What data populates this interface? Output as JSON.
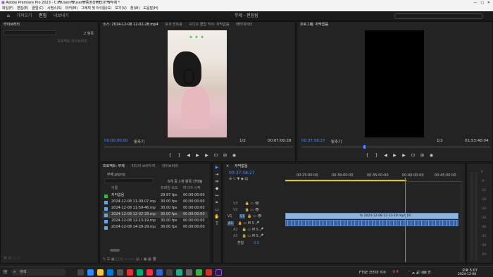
{
  "window": {
    "title": "Adobe Premiere Pro 2023 - C:₩Users₩user₩동영상₩EDIT₩무제 *"
  },
  "menu": [
    "파일(F)",
    "편집(E)",
    "클립(C)",
    "시퀀스(S)",
    "마커(M)",
    "그래픽 및 타이틀(G)",
    "보기(V)",
    "창(W)",
    "도움말(H)"
  ],
  "workspaces": {
    "home": "⌂",
    "items": [
      "가져오기",
      "편집",
      "내보내기"
    ],
    "active": "편집",
    "title": "무제 - 편집됨"
  },
  "project_left": {
    "tab": "라이브러리",
    "label_right": "2 항목",
    "sub": "프로젝트 라이브러리"
  },
  "source": {
    "tabs": [
      "소스: 2024-12-08 12-02-28.mp4",
      "효과 컨트롤",
      "오디오 클립 믹서: 자막없음",
      "메타데이터"
    ],
    "timecode": "00:00:00:00",
    "fit": "맞추기",
    "ratio": "1/2",
    "duration": "00:07:00:28"
  },
  "program": {
    "tab": "프로그램: 자막없음",
    "timecode": "00:37:58:27",
    "fit": "맞추기",
    "ratio": "1/2",
    "duration": "01:53:40:04"
  },
  "project": {
    "tabs": [
      "프로젝트: 무제",
      "미디어 브라우저",
      "라이브러리"
    ],
    "name": "무제.prproj",
    "count": "6개 중 1개 항목 선택됨",
    "columns": [
      "이름",
      "프레임 속도",
      "미디어 시작"
    ],
    "rows": [
      {
        "name": "자막없음",
        "fps": "29.97 fps",
        "start": "00:00:00:00",
        "color": "#3fb24f"
      },
      {
        "name": "2024-12-08 11-09-07.mp",
        "fps": "30.00 fps",
        "start": "00:00:00:00",
        "color": "#6aa4d8"
      },
      {
        "name": "2024-12-08 11-59-46.mp",
        "fps": "30.00 fps",
        "start": "00:00:00:00",
        "color": "#6aa4d8"
      },
      {
        "name": "2024-12-08 12-02-28.mp",
        "fps": "30.00 fps",
        "start": "00:00:00:00",
        "color": "#6aa4d8"
      },
      {
        "name": "2024-12-08 12-13-19.mp",
        "fps": "30.00 fps",
        "start": "00:00:00:00",
        "color": "#6aa4d8"
      },
      {
        "name": "2024-12-08 14-29-29.mp",
        "fps": "30.00 fps",
        "start": "00:00:00:00",
        "color": "#6aa4d8"
      }
    ]
  },
  "timeline": {
    "tab": "자막없음",
    "timecode": "00:37:58:27",
    "ruler": [
      "00:25:00:00",
      "00:30:00:00",
      "00:35:00:00",
      "00:40:00:00",
      "00:45:00:00"
    ],
    "video_tracks": [
      "V3",
      "V2",
      "V1"
    ],
    "audio_tracks": [
      "A1",
      "A2",
      "A3"
    ],
    "master": "혼합",
    "master_val": "0.0",
    "clip_label": "fx 2024-12-08 12-13-19.mp4 [V]"
  },
  "meter": {
    "scale": [
      "0",
      "-6",
      "-12",
      "-18",
      "-24",
      "-30",
      "-36",
      "-42",
      "-48",
      "-54"
    ]
  },
  "taskbar": {
    "search": "검색",
    "news": "FTSE 코리아 지수",
    "news_val": "-0.4",
    "time": "오후 5:07",
    "date": "2024-12-08"
  }
}
